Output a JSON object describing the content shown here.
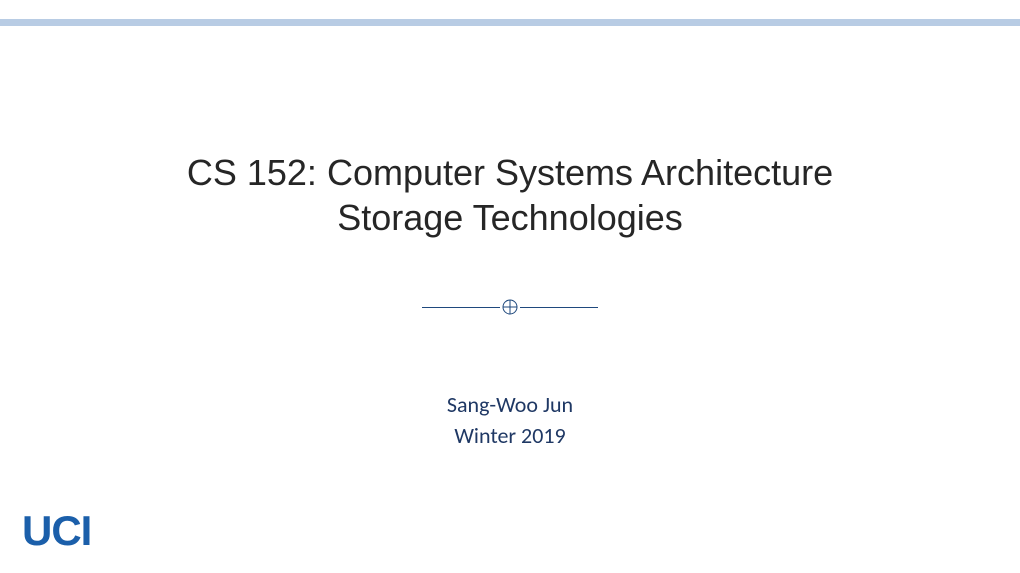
{
  "title": {
    "line1": "CS 152: Computer Systems Architecture",
    "line2": "Storage Technologies"
  },
  "author": {
    "name": "Sang-Woo Jun",
    "term": "Winter 2019"
  },
  "logo": {
    "text": "UCI"
  },
  "colors": {
    "topBar": "#b8cce4",
    "titleText": "#262626",
    "divider": "#1f497d",
    "authorText": "#1f3864",
    "logoText": "#1b5faa"
  }
}
